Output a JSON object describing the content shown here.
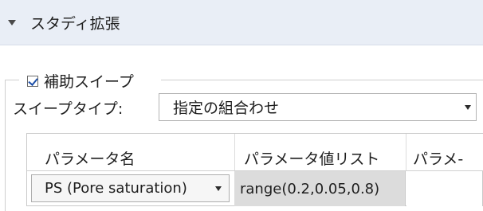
{
  "section": {
    "title": "スタディ拡張"
  },
  "aux_sweep": {
    "label": "補助スイープ",
    "checked": true
  },
  "sweep_type": {
    "label": "スイープタイプ:",
    "value": "指定の組合わせ"
  },
  "table": {
    "headers": [
      "パラメータ名",
      "パラメータ値リスト",
      "パラメ-"
    ],
    "rows": [
      {
        "parameter": "PS (Pore saturation)",
        "values": "range(0.2,0.05,0.8)",
        "unit": ""
      }
    ]
  },
  "colors": {
    "header_background": "#e9eef6",
    "checkbox_check": "#1d4fa8",
    "values_cell_background": "#dcdcdc"
  }
}
